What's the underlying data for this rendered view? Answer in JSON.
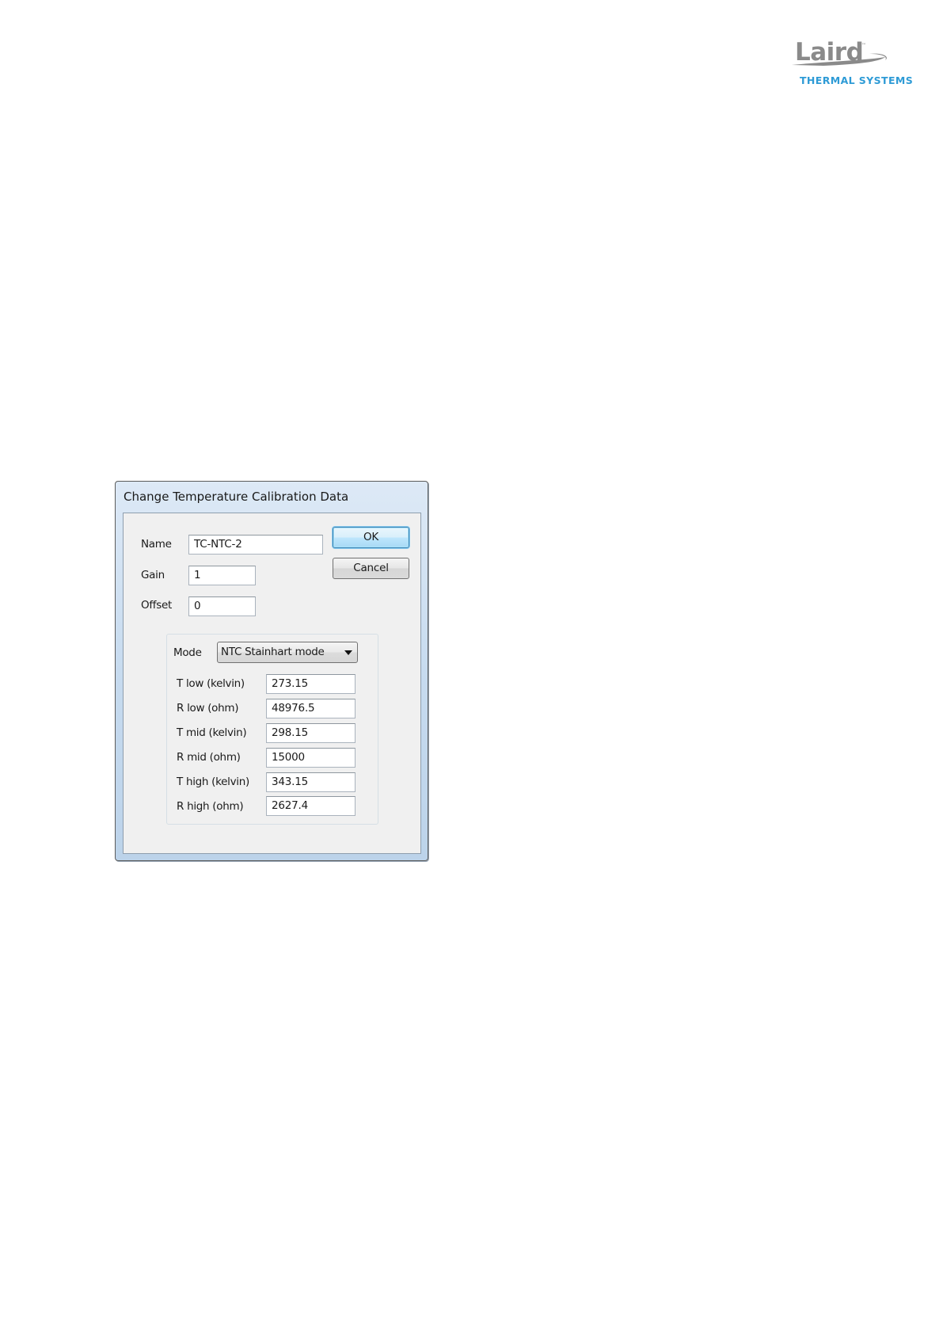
{
  "logo": {
    "brand": "Laird",
    "trademark": "™",
    "subtitle": "THERMAL SYSTEMS",
    "colors": {
      "brand": "#8a8a8a",
      "subtitle": "#2e9bd6"
    }
  },
  "dialog": {
    "title": "Change Temperature Calibration Data",
    "fields": {
      "name": {
        "label": "Name",
        "value": "TC-NTC-2"
      },
      "gain": {
        "label": "Gain",
        "value": "1"
      },
      "offset": {
        "label": "Offset",
        "value": "0"
      }
    },
    "buttons": {
      "ok": "OK",
      "cancel": "Cancel"
    },
    "mode": {
      "label": "Mode",
      "selected": "NTC Stainhart mode"
    },
    "calibration": {
      "t_low": {
        "label": "T low (kelvin)",
        "value": "273.15"
      },
      "r_low": {
        "label": "R low (ohm)",
        "value": "48976.5"
      },
      "t_mid": {
        "label": "T mid (kelvin)",
        "value": "298.15"
      },
      "r_mid": {
        "label": "R mid (ohm)",
        "value": "15000"
      },
      "t_high": {
        "label": "T high (kelvin)",
        "value": "343.15"
      },
      "r_high": {
        "label": "R high (ohm)",
        "value": "2627.4"
      }
    }
  }
}
